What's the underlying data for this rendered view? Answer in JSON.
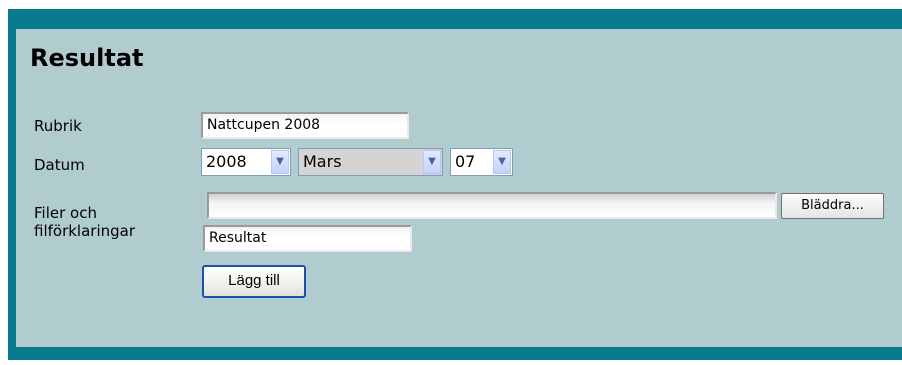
{
  "form": {
    "title": "Resultat",
    "rubrik_label": "Rubrik",
    "rubrik_value": "Nattcupen 2008",
    "datum_label": "Datum",
    "datum_year": "2008",
    "datum_month": "Mars",
    "datum_day": "07",
    "files_label_line1": "Filer och",
    "files_label_line2": "filförklaringar",
    "file_path_value": "",
    "browse_label": "Bläddra...",
    "file_description_value": "Resultat",
    "add_label": "Lägg till"
  },
  "icons": {
    "dropdown_arrow": "chevron-down-icon"
  },
  "colors": {
    "frame": "#077a8d",
    "panel": "#b1cccf",
    "button_border": "#1c4fae"
  }
}
